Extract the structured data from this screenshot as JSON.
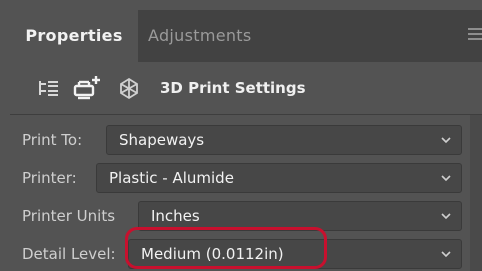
{
  "tabs": [
    {
      "label": "Properties",
      "active": true
    },
    {
      "label": "Adjustments",
      "active": false
    }
  ],
  "toolbar": {
    "title": "3D Print Settings",
    "icons": [
      "layers-tree-icon",
      "printer-add-icon",
      "scene-3d-icon"
    ]
  },
  "fields": [
    {
      "label": "Print To:",
      "value": "Shapeways"
    },
    {
      "label": "Printer:",
      "value": "Plastic - Alumide"
    },
    {
      "label": "Printer Units",
      "value": "Inches"
    },
    {
      "label": "Detail Level:",
      "value": "Medium (0.0112in)",
      "highlighted": true
    }
  ],
  "colors": {
    "panel_bg": "#535353",
    "tab_bar_bg": "#424242",
    "highlight": "#c8102e"
  }
}
